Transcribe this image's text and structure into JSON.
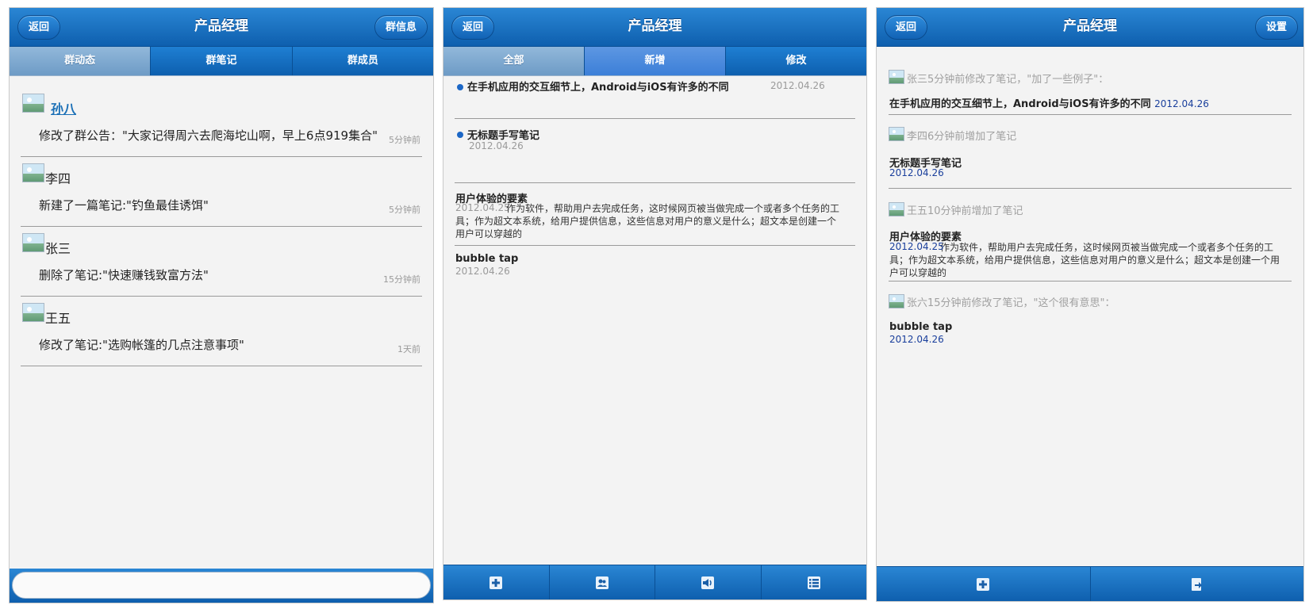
{
  "screen1": {
    "title": "产品经理",
    "back": "返回",
    "right_button": "群信息",
    "tabs": [
      "群动态",
      "群笔记",
      "群成员"
    ],
    "feed": [
      {
        "name": "孙八",
        "action": "修改了群公告：\"大家记得周六去爬海坨山啊，早上6点919集合\"",
        "time": "5分钟前"
      },
      {
        "name": "李四",
        "action": "新建了一篇笔记:\"钓鱼最佳诱饵\"",
        "time": "5分钟前"
      },
      {
        "name": "张三",
        "action": "删除了笔记:\"快速赚钱致富方法\"",
        "time": "15分钟前"
      },
      {
        "name": "王五",
        "action": "修改了笔记:\"选购帐篷的几点注意事项\"",
        "time": "1天前"
      }
    ],
    "input_placeholder": ""
  },
  "screen2": {
    "title": "产品经理",
    "back": "返回",
    "tabs": [
      "全部",
      "新增",
      "修改"
    ],
    "notes": [
      {
        "title": "在手机应用的交互细节上，Android与iOS有许多的不同",
        "date": "2012.04.26"
      },
      {
        "title": "无标题手写笔记",
        "date": "2012.04.26"
      },
      {
        "title": "用户体验的要素",
        "date": "2012.04.25",
        "text": "作为软件，帮助用户去完成任务，这时候网页被当做完成一个或者多个任务的工具；作为超文本系统，给用户提供信息，这些信息对用户的意义是什么；超文本是创建一个用户可以穿越的"
      },
      {
        "title": "bubble tap",
        "date": "2012.04.26"
      }
    ],
    "footer_icons": [
      "plus-icon",
      "group-icon",
      "speaker-icon",
      "list-icon"
    ]
  },
  "screen3": {
    "title": "产品经理",
    "back": "返回",
    "right_button": "设置",
    "activities": [
      {
        "meta": "张三5分钟前修改了笔记，\"加了一些例子\"：",
        "title": "在手机应用的交互细节上，Android与iOS有许多的不同",
        "date": "2012.04.26"
      },
      {
        "meta": "李四6分钟前增加了笔记",
        "title": "无标题手写笔记",
        "date": "2012.04.26"
      },
      {
        "meta": "王五10分钟前增加了笔记",
        "title": "用户体验的要素",
        "date": "2012.04.25",
        "text": "作为软件，帮助用户去完成任务，这时候网页被当做完成一个或者多个任务的工具；作为超文本系统，给用户提供信息，这些信息对用户的意义是什么；超文本是创建一个用户可以穿越的"
      },
      {
        "meta": "张六15分钟前修改了笔记，\"这个很有意思\"：",
        "title": "bubble tap",
        "date": "2012.04.26"
      }
    ],
    "footer_icons": [
      "plus-icon",
      "export-icon"
    ]
  }
}
